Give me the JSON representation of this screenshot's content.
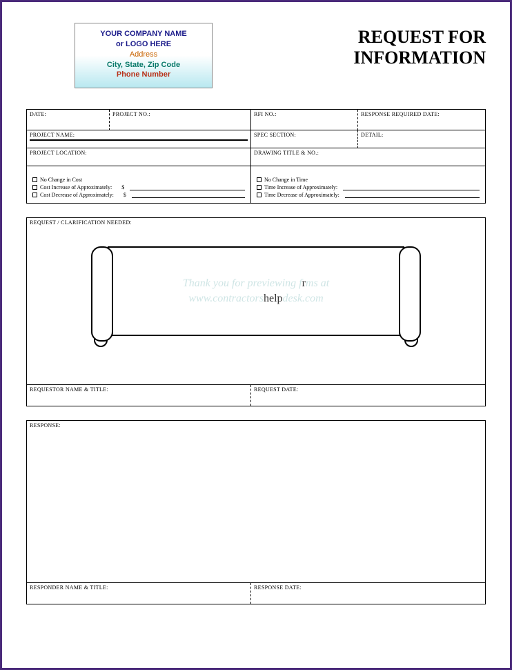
{
  "header": {
    "company": {
      "line1": "YOUR COMPANY NAME",
      "line2": "or LOGO HERE",
      "line3": "Address",
      "line4": "City, State, Zip Code",
      "line5": "Phone Number"
    },
    "title_line1": "REQUEST FOR",
    "title_line2": "INFORMATION"
  },
  "info": {
    "date": "DATE:",
    "project_no": "PROJECT NO.:",
    "rfi_no": "RFI NO.:",
    "response_required": "RESPONSE REQUIRED DATE:",
    "project_name": "PROJECT NAME:",
    "spec_section": "SPEC SECTION:",
    "detail": "DETAIL:",
    "project_location": "PROJECT LOCATION:",
    "drawing_title": "DRAWING TITLE & NO.:"
  },
  "cost": {
    "no_change": "No Change in Cost",
    "increase": "Cost Increase of Approximately:",
    "decrease": "Cost Decrease of Approximately:",
    "currency": "$"
  },
  "time": {
    "no_change": "No Change in Time",
    "increase": "Time Increase of Approximately:",
    "decrease": "Time Decrease of Approximately:"
  },
  "request": {
    "section_label": "REQUEST / CLARIFICATION NEEDED:",
    "watermark_line1_a": "Thank you for previewing f",
    "watermark_line1_b": "r",
    "watermark_line1_c": "ms at",
    "watermark_line2_a": "www.contractors",
    "watermark_line2_b": "help",
    "watermark_line2_c": "desk.com",
    "requestor_label": "REQUESTOR NAME & TITLE:",
    "request_date_label": "REQUEST DATE:"
  },
  "response": {
    "section_label": "RESPONSE:",
    "responder_label": "RESPONDER NAME & TITLE:",
    "response_date_label": "RESPONSE DATE:"
  }
}
